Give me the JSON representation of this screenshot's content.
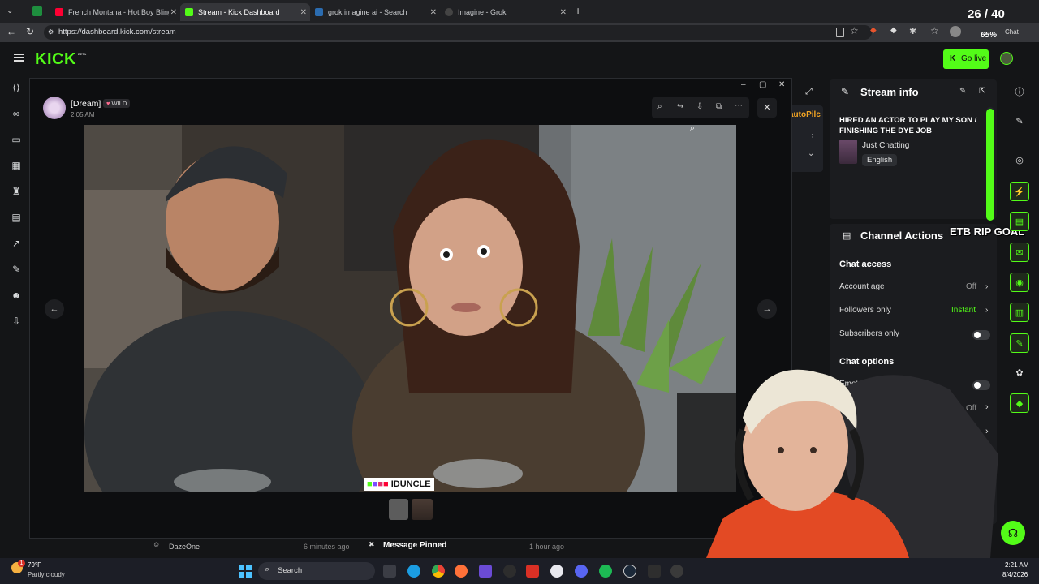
{
  "browser": {
    "tabs": [
      {
        "label": "French Montana - Hot Boy Bling ft",
        "active": false
      },
      {
        "label": "Stream - Kick Dashboard",
        "active": true
      },
      {
        "label": "grok imagine ai - Search",
        "active": false
      },
      {
        "label": "Imagine - Grok",
        "active": false
      }
    ],
    "url": "https://dashboard.kick.com/stream",
    "overlay_counter": "26 / 40",
    "zoom": "65%",
    "chat_label": "Chat"
  },
  "kick": {
    "logo": "KICK",
    "beta": "BETA",
    "go_live": "Go live",
    "stream_info": {
      "heading": "Stream info",
      "title": "HIRED AN ACTOR TO PLAY MY SON / FINISHING THE DYE JOB",
      "category": "Just Chatting",
      "language": "English"
    },
    "autopilot_partial": "autoPilc",
    "channel_actions": {
      "heading": "Channel Actions",
      "overlay_text": "ETB RIP GOAL",
      "chat_access": "Chat access",
      "rows": [
        {
          "label": "Account age",
          "value": "Off"
        },
        {
          "label": "Followers only",
          "value": "Instant"
        },
        {
          "label": "Subscribers only",
          "value": ""
        }
      ],
      "chat_options": "Chat options",
      "emotes_only": "Emotes only",
      "slow_value": "Off"
    },
    "bottom": {
      "left_user": "DazeOne",
      "left_time": "6 minutes ago",
      "pinned": "Message Pinned",
      "pinned_time": "1 hour ago"
    }
  },
  "viewer": {
    "username": "[Dream]",
    "badge": "WILD",
    "time": "2:05 AM",
    "photo_caption": "IDUNCLE"
  },
  "taskbar": {
    "weather_temp": "79°F",
    "weather_desc": "Partly cloudy",
    "search": "Search",
    "time": "2:21 AM",
    "date": "8/4/2026",
    "notif": "1"
  },
  "colors": {
    "kick_green": "#53fc18",
    "panel": "#1b1c1f",
    "youtube_red": "#ff0033"
  }
}
